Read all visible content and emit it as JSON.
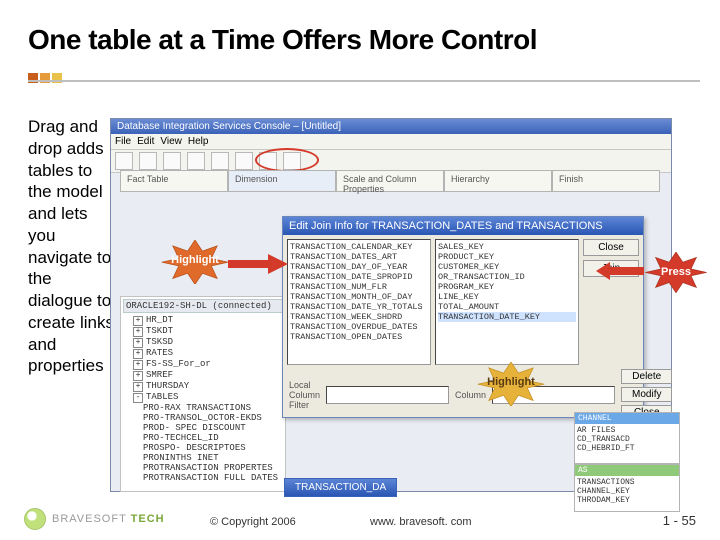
{
  "title": "One table at a Time Offers More Control",
  "dots": [
    "#c85e1b",
    "#e79a3a",
    "#e8c24a"
  ],
  "body": "Drag and drop adds tables to the model and lets you navigate to the dialogue to create links and properties",
  "app": {
    "title": "Database Integration Services Console – [Untitled]",
    "menu": [
      "File",
      "Edit",
      "View",
      "Help"
    ],
    "wizard": [
      "Fact Table",
      "Dimension",
      "Scale and Column Properties",
      "Hierarchy",
      "Finish"
    ],
    "wizard_selected": 1
  },
  "tree": {
    "header": "ORACLE192-SH-DL (connected)",
    "nodes": [
      "HR_DT",
      "TSKDT",
      "TSKSD",
      "RATES",
      "FS-SS_For_or",
      "SMREF",
      "THURSDAY",
      "TABLES"
    ],
    "subnodes": [
      "PRO-RAX TRANSACTIONS",
      "PRO-TRANSOL_OCTOR-EKDS",
      "PROD- SPEC DISCOUNT",
      "PRO-TECHCEL_ID",
      "PROSPO- DESCRIPTOES",
      "PRONINTHS INET",
      "PROTRANSACTION PROPERTES",
      "PROTRANSACTION FULL DATES"
    ]
  },
  "dialog": {
    "title": "Edit Join Info for TRANSACTION_DATES and TRANSACTIONS",
    "left_list": [
      "TRANSACTION_CALENDAR_KEY",
      "TRANSACTION_DATES_ART",
      "TRANSACTION_DAY_OF_YEAR",
      "TRANSACTION_DATE_SPROPID",
      "TRANSACTION_NUM_FLR",
      "TRANSACTION_MONTH_OF_DAY",
      "TRANSACTION_DATE_YR_TOTALS",
      "TRANSACTION_WEEK_SHDRD",
      "TRANSACTION_OVERDUE_DATES",
      "TRANSACTION_OPEN_DATES"
    ],
    "right_list": [
      "SALES_KEY",
      "PRODUCT_KEY",
      "CUSTOMER_KEY",
      "OR_TRANSACTION_ID",
      "PROGRAM_KEY",
      "LINE_KEY",
      "TOTAL_AMOUNT",
      "TRANSACTION_DATE_KEY"
    ],
    "right_selected": 7,
    "buttons": {
      "close": "Close",
      "join": "Join",
      "delete": "Delete",
      "modify": "Modify",
      "close2": "Close"
    },
    "lower": {
      "label1": "Local Column Filter",
      "label2": "Column"
    }
  },
  "bursts": {
    "highlight": "Highlight",
    "press": "Press"
  },
  "float_label": "TRANSACTION_DA",
  "right_panels": {
    "p1": {
      "hdr": "CHANNEL",
      "rows": [
        "AR FILES",
        "CD_TRANSACD",
        "CD_HEBRID_FT"
      ]
    },
    "p2": {
      "hdr": "AS",
      "rows": [
        "TRANSACTIONS",
        " CHANNEL_KEY",
        " THRODAM_KEY"
      ]
    }
  },
  "footer": {
    "logo_text_a": "BRAVESOFT",
    "logo_text_b": "TECH",
    "copyright": "© Copyright 2006",
    "url": "www. bravesoft. com",
    "page": "1 - 55"
  }
}
